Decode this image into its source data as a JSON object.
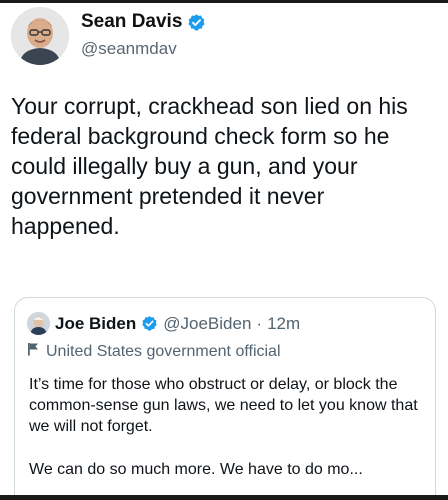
{
  "tweet": {
    "author": {
      "name": "Sean Davis",
      "handle": "@seanmdav",
      "verified": true
    },
    "text": "Your corrupt, crackhead son lied on his federal background check form so he could illegally buy a gun, and your government pretended it never happened."
  },
  "quoted_tweet": {
    "author": {
      "name": "Joe Biden",
      "handle": "@JoeBiden",
      "verified": true
    },
    "separator": "·",
    "time": "12m",
    "label": "United States government official",
    "text_para1": "It’s time for those who obstruct or delay, or block the common-sense gun laws, we need to let you know that we will not forget.",
    "text_para2": "We can do so much more. We have to do mo..."
  },
  "colors": {
    "verified_badge": "#1d9bf0",
    "muted_text": "#536471",
    "border": "#cfd9de"
  }
}
